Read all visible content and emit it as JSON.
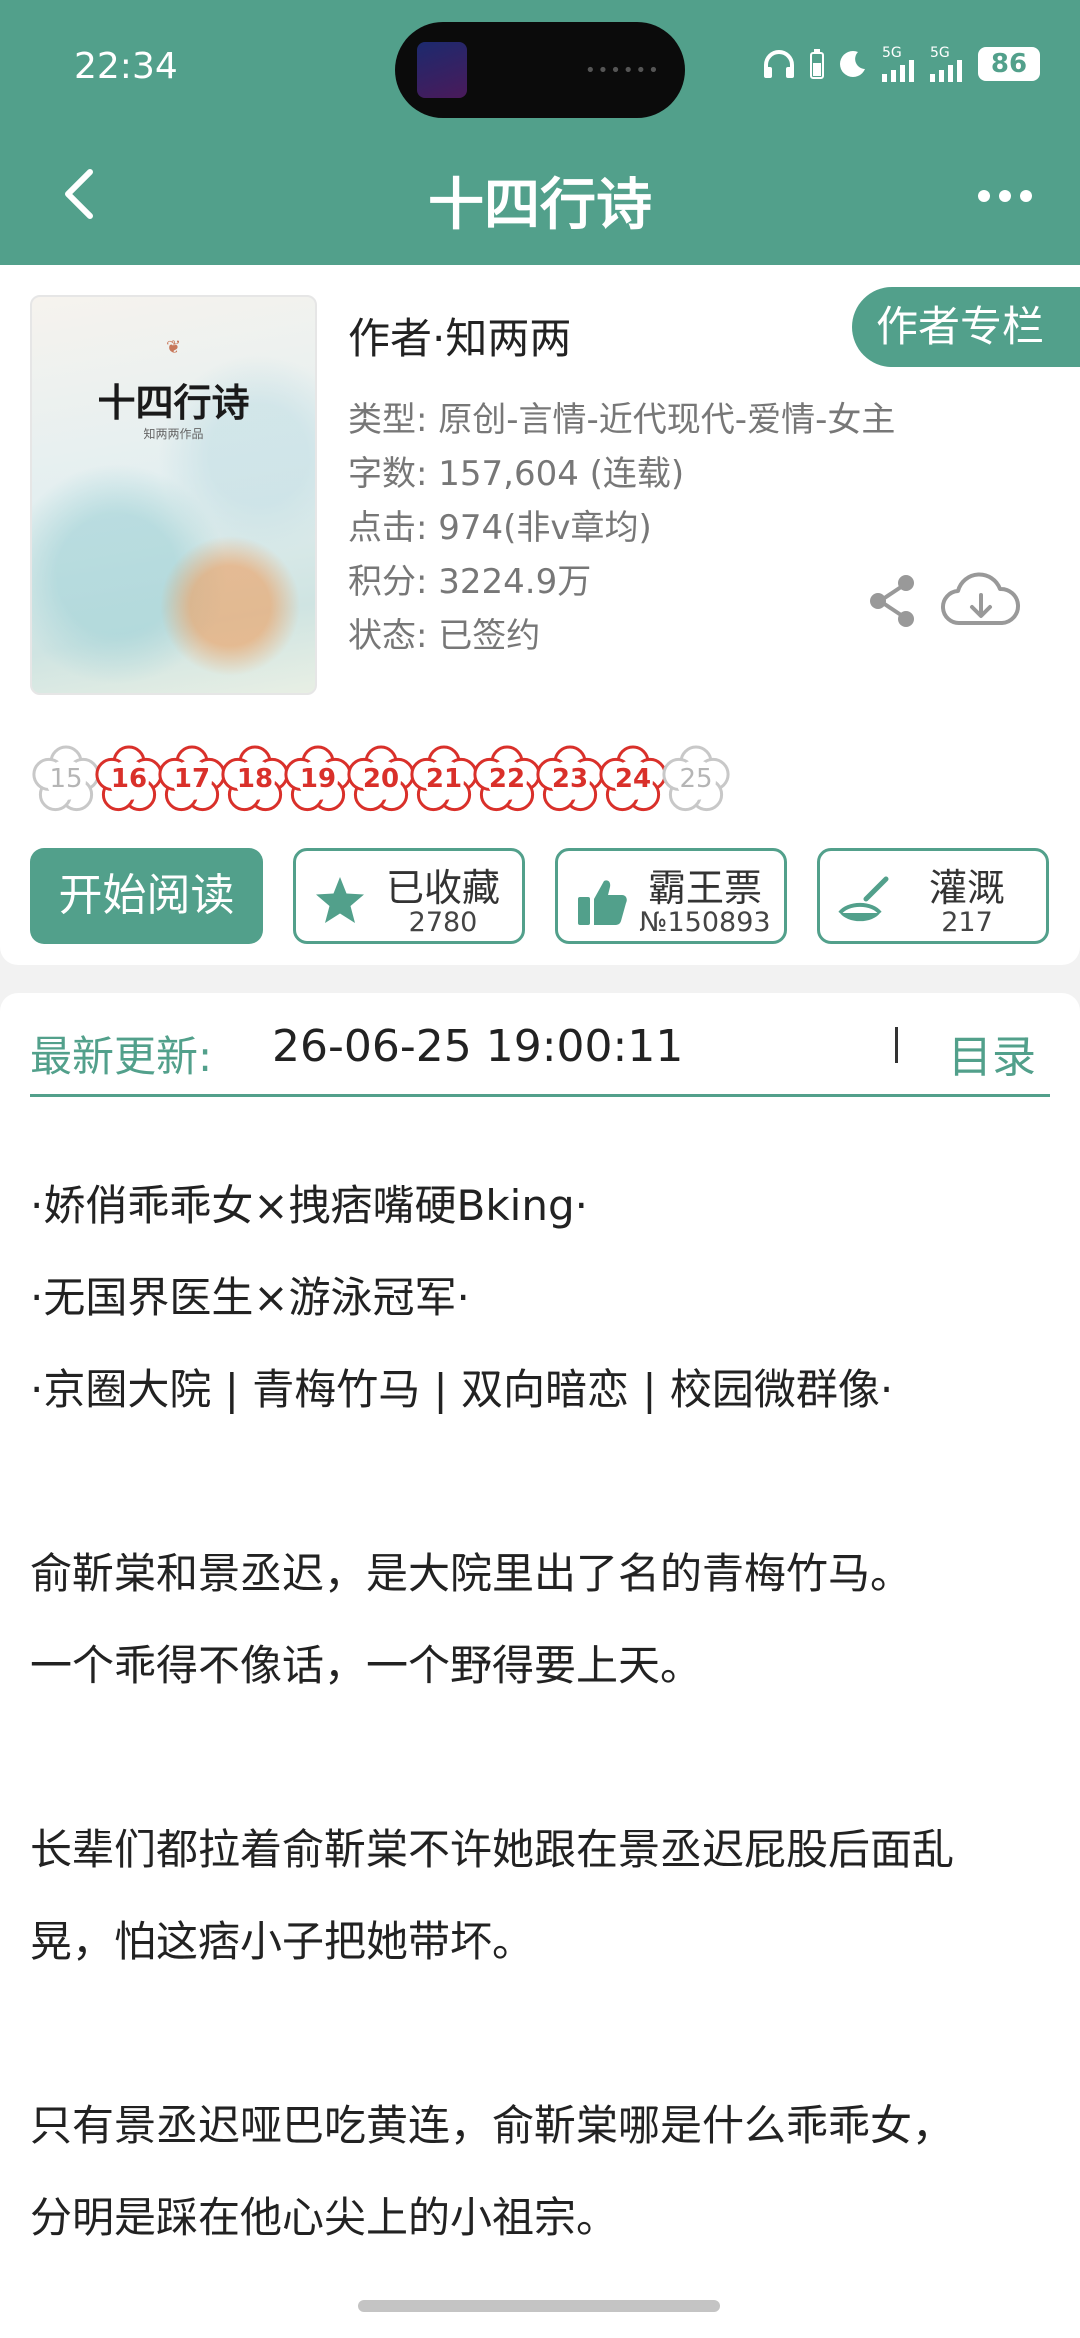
{
  "status_bar": {
    "time": "22:34",
    "signal1": "5G",
    "signal2": "5G",
    "battery": "86"
  },
  "nav": {
    "title": "十四行诗"
  },
  "book": {
    "cover_title": "十四行诗",
    "cover_subtitle": "知两两作品",
    "author": "作者·知两两",
    "author_column_button": "作者专栏",
    "meta": [
      "类型: 原创-言情-近代现代-爱情-女主",
      "字数: 157,604 (连载)",
      "点击: 974(非v章均)",
      "积分: 3224.9万",
      "状态: 已签约"
    ]
  },
  "flowers": [
    {
      "label": "15",
      "dim": true
    },
    {
      "label": "16",
      "dim": false
    },
    {
      "label": "17",
      "dim": false
    },
    {
      "label": "18",
      "dim": false
    },
    {
      "label": "19",
      "dim": false
    },
    {
      "label": "20",
      "dim": false
    },
    {
      "label": "21",
      "dim": false
    },
    {
      "label": "22",
      "dim": false
    },
    {
      "label": "23",
      "dim": false
    },
    {
      "label": "24",
      "dim": false
    },
    {
      "label": "25",
      "dim": true
    }
  ],
  "actions": {
    "read": "开始阅读",
    "favorite": {
      "label": "已收藏",
      "count": "2780"
    },
    "ticket": {
      "label": "霸王票",
      "count": "№150893"
    },
    "water": {
      "label": "灌溉",
      "count": "217"
    }
  },
  "update": {
    "label": "最新更新:",
    "time": "26-06-25 19:00:11",
    "toc": "目录"
  },
  "synopsis": [
    "·娇俏乖乖女×拽痞嘴硬Bking·",
    "·无国界医生×游泳冠军·",
    "·京圈大院 | 青梅竹马 | 双向暗恋 | 校园微群像·",
    "俞靳棠和景丞迟，是大院里出了名的青梅竹马。",
    "一个乖得不像话，一个野得要上天。",
    "长辈们都拉着俞靳棠不许她跟在景丞迟屁股后面乱",
    "晃，怕这痞小子把她带坏。",
    "只有景丞迟哑巴吃黄连，俞靳棠哪是什么乖乖女，",
    "分明是踩在他心尖上的小祖宗。"
  ],
  "colors": {
    "accent": "#52a08b",
    "flower_red": "#d9302a"
  }
}
